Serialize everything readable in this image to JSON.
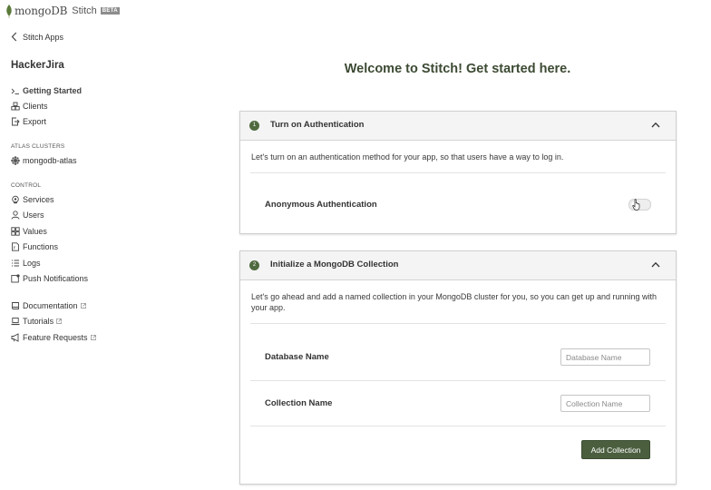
{
  "header": {
    "brand": "mongoDB",
    "product": "Stitch",
    "badge": "BETA"
  },
  "sidebar": {
    "back_label": "Stitch Apps",
    "app_name": "HackerJira",
    "top_items": [
      {
        "label": "Getting Started",
        "icon": "terminal-prompt-icon",
        "active": true
      },
      {
        "label": "Clients",
        "icon": "clients-icon"
      },
      {
        "label": "Export",
        "icon": "export-icon"
      }
    ],
    "atlas_section": "ATLAS CLUSTERS",
    "atlas_items": [
      {
        "label": "mongodb-atlas",
        "icon": "cluster-icon"
      }
    ],
    "control_section": "CONTROL",
    "control_items": [
      {
        "label": "Services",
        "icon": "services-icon"
      },
      {
        "label": "Users",
        "icon": "user-icon"
      },
      {
        "label": "Values",
        "icon": "values-icon"
      },
      {
        "label": "Functions",
        "icon": "functions-icon"
      },
      {
        "label": "Logs",
        "icon": "logs-icon"
      },
      {
        "label": "Push Notifications",
        "icon": "push-icon"
      }
    ],
    "help_items": [
      {
        "label": "Documentation",
        "icon": "book-icon"
      },
      {
        "label": "Tutorials",
        "icon": "laptop-icon"
      },
      {
        "label": "Feature Requests",
        "icon": "megaphone-icon"
      }
    ]
  },
  "main": {
    "welcome": "Welcome to Stitch! Get started here.",
    "auth_card": {
      "step": "1",
      "title": "Turn on Authentication",
      "description": "Let's turn on an authentication method for your app, so that users have a way to log in.",
      "option_label": "Anonymous Authentication",
      "toggle_on": false
    },
    "collection_card": {
      "step": "2",
      "title": "Initialize a MongoDB Collection",
      "description": "Let's go ahead and add a named collection in your MongoDB cluster for you, so you can get up and running with your app.",
      "db_label": "Database Name",
      "db_value": "",
      "db_placeholder": "Database Name",
      "coll_label": "Collection Name",
      "coll_value": "",
      "coll_placeholder": "Collection Name",
      "button_label": "Add Collection"
    }
  },
  "colors": {
    "accent": "#4b5f3f",
    "heading": "#3c4a33",
    "card_header_bg": "#f4f4f4"
  }
}
